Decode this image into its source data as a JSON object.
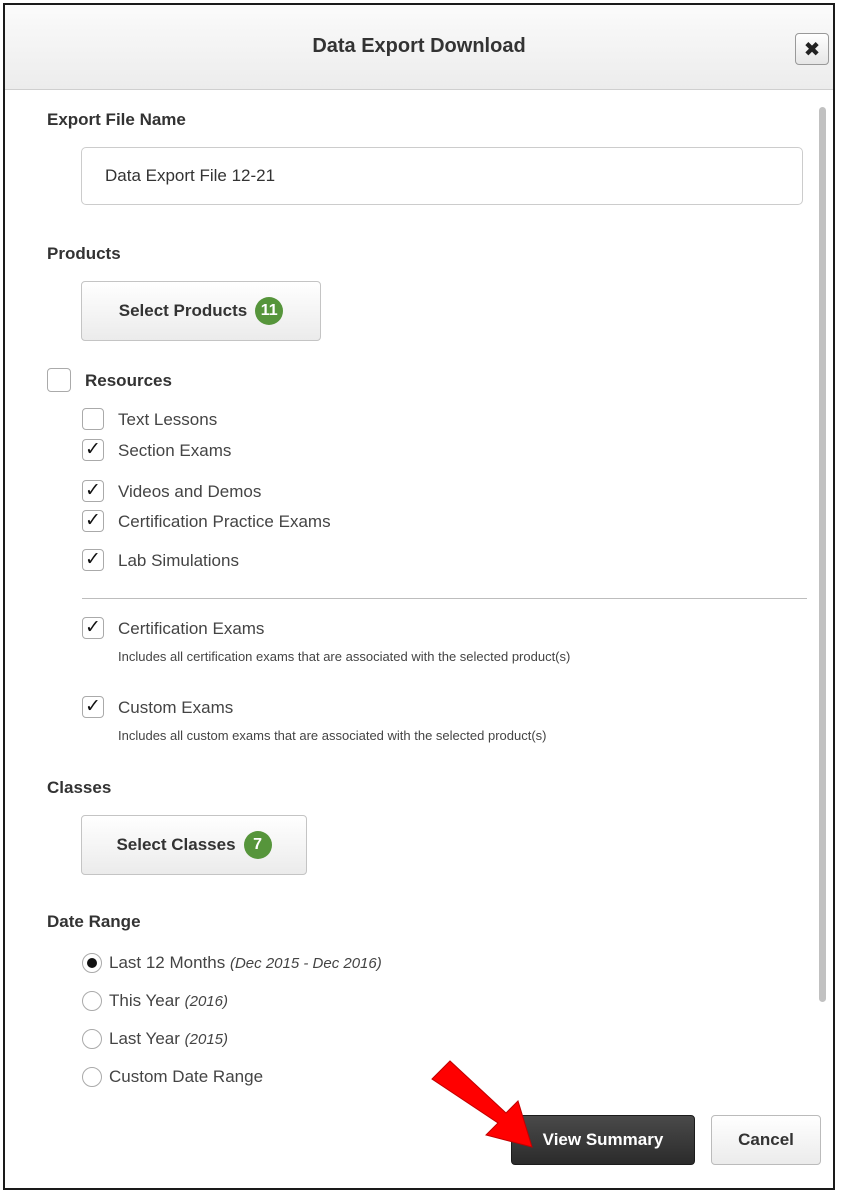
{
  "dialog": {
    "title": "Data Export Download",
    "close_glyph": "✖"
  },
  "export_file": {
    "label": "Export File Name",
    "value": "Data Export File 12-21"
  },
  "products": {
    "label": "Products",
    "button_label": "Select Products",
    "count": "11"
  },
  "resources": {
    "label": "Resources",
    "checked": false,
    "items": [
      {
        "label": "Text Lessons",
        "checked": false
      },
      {
        "label": "Section Exams",
        "checked": true
      },
      {
        "label": "Videos and Demos",
        "checked": true
      },
      {
        "label": "Certification Practice Exams",
        "checked": true
      },
      {
        "label": "Lab Simulations",
        "checked": true
      }
    ],
    "exams": [
      {
        "label": "Certification Exams",
        "checked": true,
        "help": "Includes all certification exams that are associated with the selected product(s)"
      },
      {
        "label": "Custom Exams",
        "checked": true,
        "help": "Includes all custom exams that are associated with the selected product(s)"
      }
    ]
  },
  "classes": {
    "label": "Classes",
    "button_label": "Select Classes",
    "count": "7"
  },
  "date_range": {
    "label": "Date Range",
    "options": [
      {
        "label": "Last 12 Months",
        "detail": "(Dec 2015 - Dec 2016)",
        "selected": true
      },
      {
        "label": "This Year",
        "detail": "(2016)",
        "selected": false
      },
      {
        "label": "Last Year",
        "detail": "(2015)",
        "selected": false
      },
      {
        "label": "Custom Date Range",
        "detail": "",
        "selected": false
      }
    ]
  },
  "footer": {
    "primary_label": "View Summary",
    "secondary_label": "Cancel"
  },
  "colors": {
    "badge": "#56953b",
    "primary_button": "#333333",
    "annotation_arrow": "#ff0000"
  },
  "checkmark_glyph": "✓"
}
